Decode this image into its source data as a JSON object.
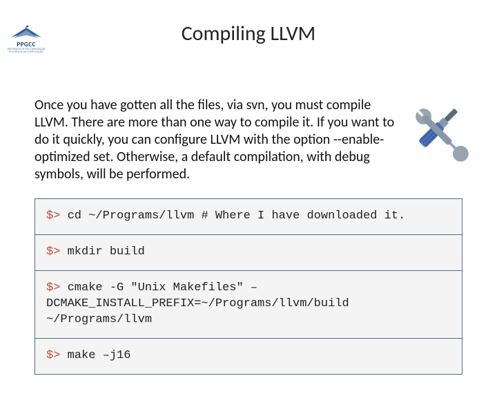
{
  "logo": {
    "acronym": "PPGCC",
    "sub1": "PROGRAMA DE PÓS-GRADUAÇÃO",
    "sub2": "EM CIÊNCIA DA COMPUTAÇÃO"
  },
  "title": "Compiling LLVM",
  "intro": "Once you have gotten all the files, via svn, you must compile LLVM. There are more than one way to compile it. If you want to do it quickly, you can configure LLVM with the option --enable-optimized set. Otherwise, a default compilation, with debug symbols, will be performed.",
  "code": {
    "prompt": "$>",
    "lines": [
      {
        "cmd": "cd ~/Programs/llvm # Where I have downloaded it."
      },
      {
        "cmd": "mkdir build"
      },
      {
        "cmd": "cmake -G \"Unix Makefiles\" –DCMAKE_INSTALL_PREFIX=~/Programs/llvm/build ~/Programs/llvm"
      },
      {
        "cmd": "make –j16"
      }
    ]
  }
}
